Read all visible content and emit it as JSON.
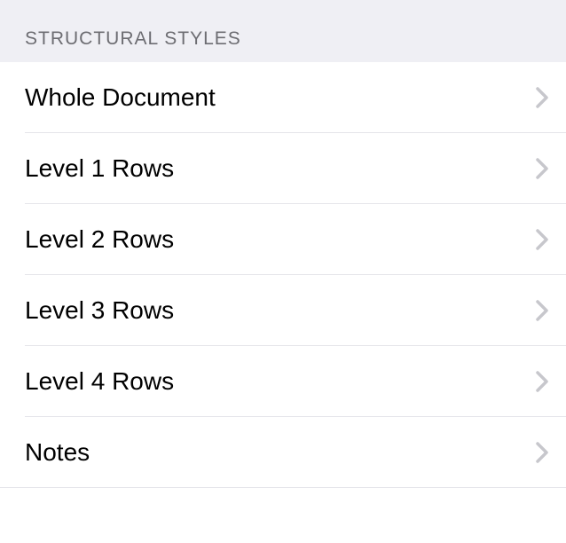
{
  "section": {
    "header": "STRUCTURAL STYLES",
    "items": [
      {
        "label": "Whole Document"
      },
      {
        "label": "Level 1 Rows"
      },
      {
        "label": "Level 2 Rows"
      },
      {
        "label": "Level 3 Rows"
      },
      {
        "label": "Level 4 Rows"
      },
      {
        "label": "Notes"
      }
    ]
  }
}
